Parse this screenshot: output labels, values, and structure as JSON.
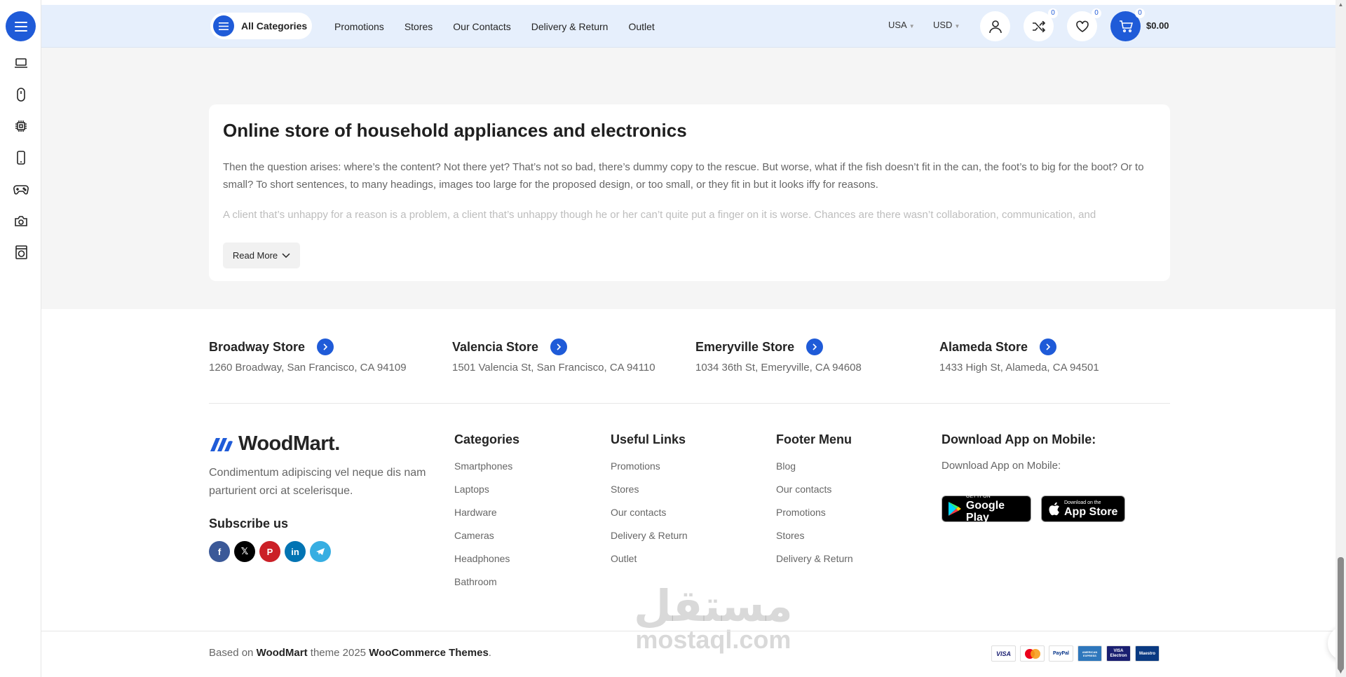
{
  "header": {
    "all_categories": "All Categories",
    "nav": [
      "Promotions",
      "Stores",
      "Our Contacts",
      "Delivery & Return",
      "Outlet"
    ],
    "country": "USA",
    "currency": "USD",
    "compare_count": "0",
    "wishlist_count": "0",
    "cart_count": "0",
    "cart_total": "$0.00"
  },
  "sidebar": {
    "icons": [
      "laptop-icon",
      "mouse-icon",
      "chip-icon",
      "phone-icon",
      "gamepad-icon",
      "camera-icon",
      "washer-icon"
    ]
  },
  "about": {
    "title": "Online store of household appliances and electronics",
    "paragraph1": "Then the question arises: where’s the content? Not there yet? That’s not so bad, there’s dummy copy to the rescue. But worse, what if the fish doesn’t fit in the can, the foot’s to big for the boot? Or to small? To short sentences, to many headings, images too large for the proposed design, or too small, or they fit in but it looks iffy for reasons.",
    "paragraph2": "A client that’s unhappy for a reason is a problem, a client that’s unhappy though he or her can’t quite put a finger on it is worse. Chances are there wasn’t collaboration, communication, and",
    "read_more": "Read More"
  },
  "stores": [
    {
      "name": "Broadway Store",
      "address": "1260 Broadway, San Francisco, CA 94109"
    },
    {
      "name": "Valencia Store",
      "address": "1501 Valencia St, San Francisco, CA 94110"
    },
    {
      "name": "Emeryville Store",
      "address": "1034 36th St, Emeryville, CA 94608"
    },
    {
      "name": "Alameda Store",
      "address": "1433 High St, Alameda, CA 94501"
    }
  ],
  "footer": {
    "logo": "WoodMart.",
    "description": "Condimentum adipiscing vel neque dis nam parturient orci at scelerisque.",
    "subscribe": "Subscribe us",
    "categories": {
      "title": "Categories",
      "links": [
        "Smartphones",
        "Laptops",
        "Hardware",
        "Cameras",
        "Headphones",
        "Bathroom"
      ]
    },
    "useful_links": {
      "title": "Useful Links",
      "links": [
        "Promotions",
        "Stores",
        "Our contacts",
        "Delivery & Return",
        "Outlet"
      ]
    },
    "footer_menu": {
      "title": "Footer Menu",
      "links": [
        "Blog",
        "Our contacts",
        "Promotions",
        "Stores",
        "Delivery & Return"
      ]
    },
    "app": {
      "title": "Download App on Mobile:",
      "subtitle": "Download App on Mobile:",
      "google_small": "GET IT ON",
      "google_big": "Google Play",
      "apple_small": "Download on the",
      "apple_big": "App Store"
    },
    "copyright": {
      "prefix": "Based on",
      "brand": "WoodMart",
      "middle": "theme 2025",
      "link": "WooCommerce Themes",
      "suffix": "."
    },
    "payments": [
      "VISA",
      "mastercard",
      "PayPal",
      "AMERICAN EXPRESS",
      "VISA Electron",
      "Maestro"
    ]
  },
  "watermark": {
    "arabic": "مستقل",
    "latin": "mostaql.com"
  },
  "colors": {
    "accent": "#1f5bd8",
    "header_bg": "#e6effc",
    "section_bg": "#f5f5f5"
  }
}
